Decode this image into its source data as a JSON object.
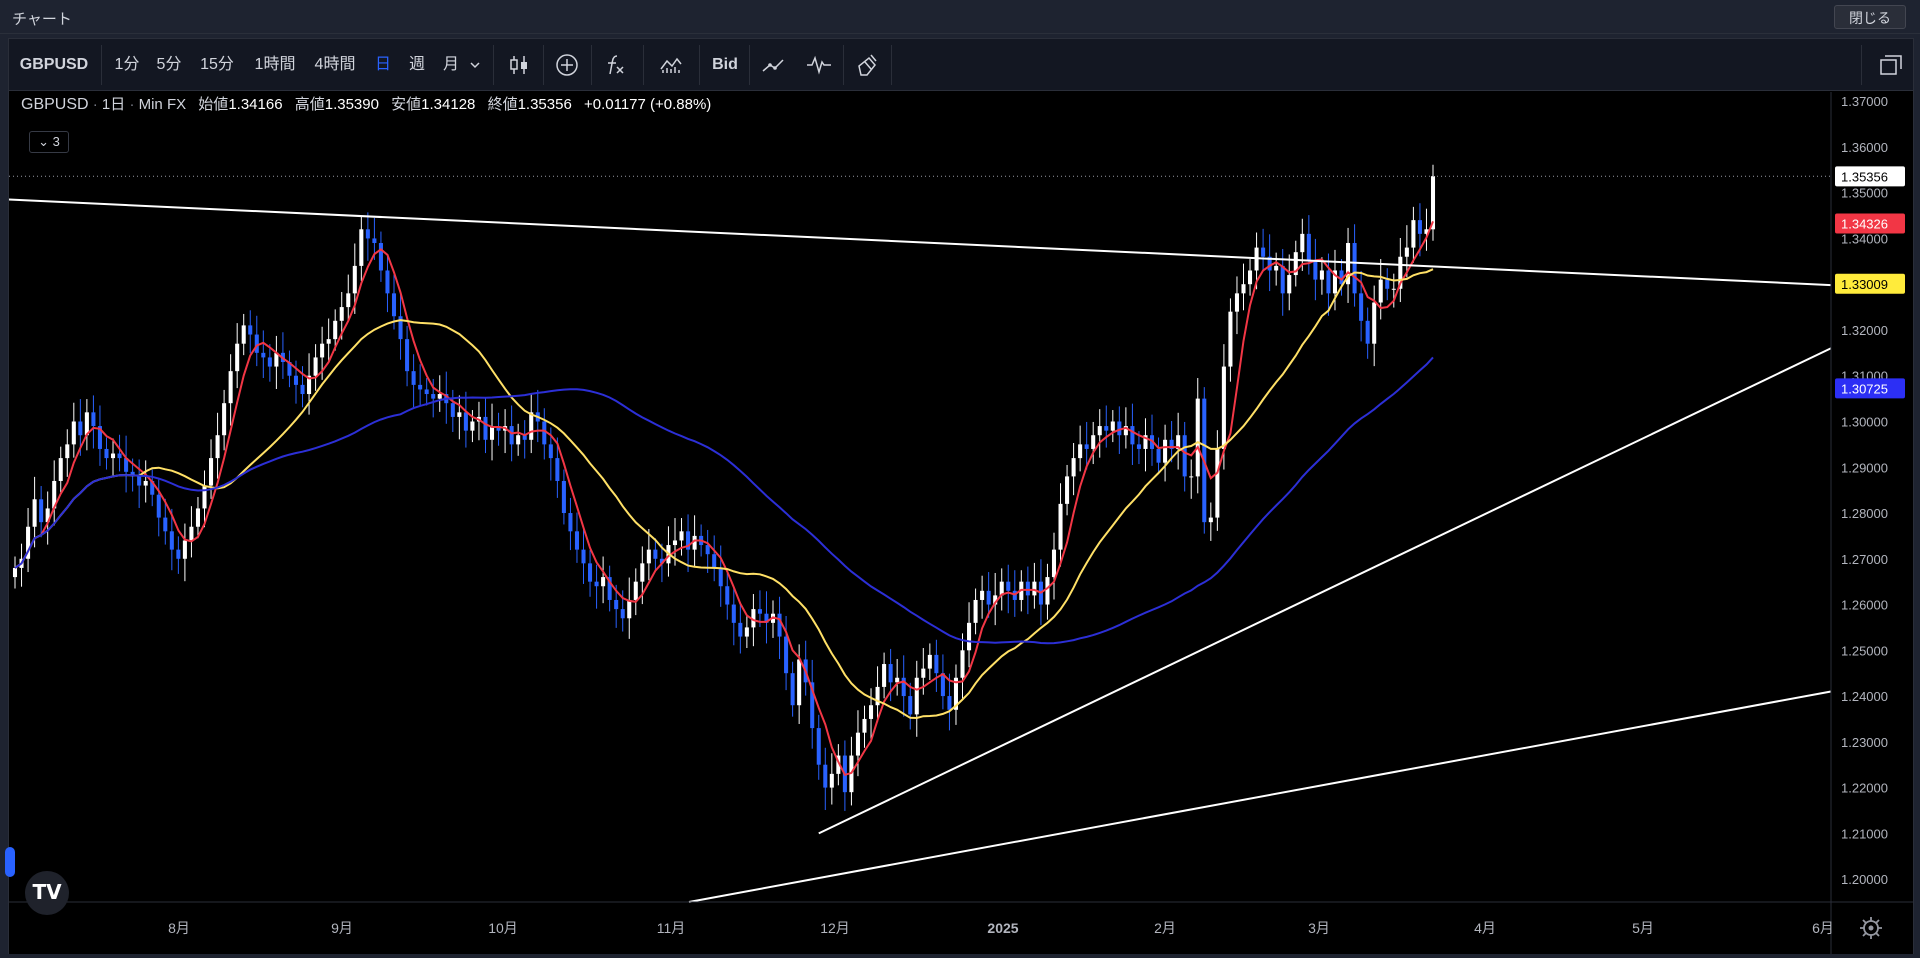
{
  "window": {
    "title": "チャート",
    "close_label": "閉じる"
  },
  "toolbar": {
    "symbol": "GBPUSD",
    "intervals": [
      "1分",
      "5分",
      "15分",
      "1時間",
      "4時間",
      "日",
      "週",
      "月"
    ],
    "active_interval": "日",
    "dropdown_icon": "chevron-down-icon",
    "bid_label": "Bid"
  },
  "legend": {
    "symbol": "GBPUSD",
    "interval": "1日",
    "source": "Min FX",
    "open_label": "始値",
    "open": "1.34166",
    "high_label": "高値",
    "high": "1.35390",
    "low_label": "安値",
    "low": "1.34128",
    "close_label": "終値",
    "close": "1.35356",
    "change": "+0.01177 (+0.88%)",
    "collapse_count": "3"
  },
  "chart_data": {
    "type": "candlestick",
    "y_axis": {
      "min": 1.195,
      "max": 1.372,
      "ticks": [
        "1.37000",
        "1.36000",
        "1.35000",
        "1.34000",
        "1.33000",
        "1.32000",
        "1.31000",
        "1.30000",
        "1.29000",
        "1.28000",
        "1.27000",
        "1.26000",
        "1.25000",
        "1.24000",
        "1.23000",
        "1.22000",
        "1.21000",
        "1.20000"
      ]
    },
    "x_axis": {
      "labels": [
        "8月",
        "9月",
        "10月",
        "11月",
        "12月",
        "2025",
        "2月",
        "3月",
        "4月",
        "5月",
        "6月"
      ]
    },
    "price_labels": [
      {
        "value": "1.35356",
        "price": 1.35356,
        "color": "#ffffff",
        "text_color": "#000000"
      },
      {
        "value": "1.34326",
        "price": 1.34326,
        "color": "#f23645",
        "text_color": "#ffffff"
      },
      {
        "value": "1.33009",
        "price": 1.33009,
        "color": "#ffeb3b",
        "text_color": "#000000"
      },
      {
        "value": "1.30725",
        "price": 1.30725,
        "color": "#2c2ff5",
        "text_color": "#ffffff"
      }
    ],
    "colors": {
      "up": "#ffffff",
      "down": "#2962ff",
      "ma_fast": "#f23645",
      "ma_mid": "#ffe066",
      "ma_slow": "#2c2fd6",
      "trend": "#ffffff"
    },
    "closes": [
      1.268,
      1.27,
      1.277,
      1.283,
      1.278,
      1.281,
      1.287,
      1.292,
      1.295,
      1.3,
      1.297,
      1.302,
      1.299,
      1.294,
      1.292,
      1.293,
      1.292,
      1.289,
      1.288,
      1.286,
      1.287,
      1.284,
      1.279,
      1.276,
      1.272,
      1.27,
      1.274,
      1.277,
      1.281,
      1.286,
      1.292,
      1.297,
      1.304,
      1.311,
      1.317,
      1.321,
      1.319,
      1.315,
      1.314,
      1.312,
      1.315,
      1.313,
      1.31,
      1.308,
      1.306,
      1.31,
      1.314,
      1.317,
      1.318,
      1.322,
      1.325,
      1.328,
      1.334,
      1.342,
      1.34,
      1.339,
      1.333,
      1.328,
      1.323,
      1.318,
      1.311,
      1.308,
      1.307,
      1.306,
      1.305,
      1.306,
      1.304,
      1.301,
      1.302,
      1.298,
      1.3,
      1.301,
      1.296,
      1.299,
      1.298,
      1.299,
      1.295,
      1.297,
      1.296,
      1.302,
      1.3,
      1.295,
      1.292,
      1.287,
      1.28,
      1.276,
      1.272,
      1.269,
      1.265,
      1.264,
      1.266,
      1.261,
      1.259,
      1.257,
      1.261,
      1.265,
      1.269,
      1.272,
      1.27,
      1.269,
      1.273,
      1.274,
      1.276,
      1.272,
      1.275,
      1.273,
      1.271,
      1.268,
      1.264,
      1.26,
      1.256,
      1.253,
      1.255,
      1.259,
      1.258,
      1.256,
      1.258,
      1.253,
      1.245,
      1.238,
      1.248,
      1.243,
      1.233,
      1.225,
      1.22,
      1.223,
      1.227,
      1.219,
      1.227,
      1.232,
      1.235,
      1.238,
      1.242,
      1.247,
      1.243,
      1.244,
      1.24,
      1.236,
      1.244,
      1.246,
      1.249,
      1.245,
      1.24,
      1.237,
      1.244,
      1.25,
      1.256,
      1.261,
      1.263,
      1.26,
      1.262,
      1.265,
      1.263,
      1.261,
      1.265,
      1.262,
      1.265,
      1.26,
      1.266,
      1.272,
      1.282,
      1.288,
      1.292,
      1.295,
      1.294,
      1.297,
      1.299,
      1.298,
      1.3,
      1.297,
      1.299,
      1.295,
      1.294,
      1.297,
      1.294,
      1.291,
      1.296,
      1.294,
      1.297,
      1.288,
      1.288,
      1.305,
      1.278,
      1.279,
      1.294,
      1.312,
      1.324,
      1.328,
      1.33,
      1.333,
      1.338,
      1.336,
      1.333,
      1.334,
      1.328,
      1.332,
      1.337,
      1.341,
      1.335,
      1.331,
      1.333,
      1.328,
      1.333,
      1.33,
      1.339,
      1.328,
      1.322,
      1.317,
      1.326,
      1.331,
      1.329,
      1.329,
      1.336,
      1.338,
      1.344,
      1.341,
      1.342,
      1.3536
    ]
  }
}
